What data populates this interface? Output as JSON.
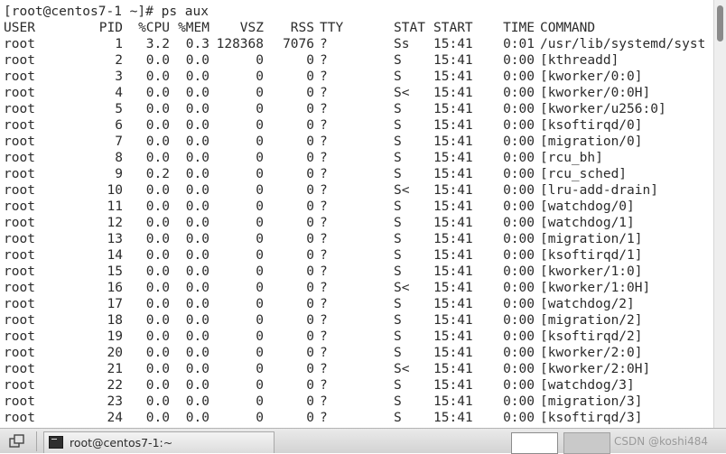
{
  "terminal": {
    "prompt": "[root@centos7-1 ~]# ps aux",
    "headers": [
      "USER",
      "PID",
      "%CPU",
      "%MEM",
      "VSZ",
      "RSS",
      "TTY",
      "STAT",
      "START",
      "TIME",
      "COMMAND"
    ],
    "rows": [
      [
        "root",
        "1",
        "3.2",
        "0.3",
        "128368",
        "7076",
        "?",
        "Ss",
        "15:41",
        "0:01",
        "/usr/lib/systemd/syst"
      ],
      [
        "root",
        "2",
        "0.0",
        "0.0",
        "0",
        "0",
        "?",
        "S",
        "15:41",
        "0:00",
        "[kthreadd]"
      ],
      [
        "root",
        "3",
        "0.0",
        "0.0",
        "0",
        "0",
        "?",
        "S",
        "15:41",
        "0:00",
        "[kworker/0:0]"
      ],
      [
        "root",
        "4",
        "0.0",
        "0.0",
        "0",
        "0",
        "?",
        "S<",
        "15:41",
        "0:00",
        "[kworker/0:0H]"
      ],
      [
        "root",
        "5",
        "0.0",
        "0.0",
        "0",
        "0",
        "?",
        "S",
        "15:41",
        "0:00",
        "[kworker/u256:0]"
      ],
      [
        "root",
        "6",
        "0.0",
        "0.0",
        "0",
        "0",
        "?",
        "S",
        "15:41",
        "0:00",
        "[ksoftirqd/0]"
      ],
      [
        "root",
        "7",
        "0.0",
        "0.0",
        "0",
        "0",
        "?",
        "S",
        "15:41",
        "0:00",
        "[migration/0]"
      ],
      [
        "root",
        "8",
        "0.0",
        "0.0",
        "0",
        "0",
        "?",
        "S",
        "15:41",
        "0:00",
        "[rcu_bh]"
      ],
      [
        "root",
        "9",
        "0.2",
        "0.0",
        "0",
        "0",
        "?",
        "S",
        "15:41",
        "0:00",
        "[rcu_sched]"
      ],
      [
        "root",
        "10",
        "0.0",
        "0.0",
        "0",
        "0",
        "?",
        "S<",
        "15:41",
        "0:00",
        "[lru-add-drain]"
      ],
      [
        "root",
        "11",
        "0.0",
        "0.0",
        "0",
        "0",
        "?",
        "S",
        "15:41",
        "0:00",
        "[watchdog/0]"
      ],
      [
        "root",
        "12",
        "0.0",
        "0.0",
        "0",
        "0",
        "?",
        "S",
        "15:41",
        "0:00",
        "[watchdog/1]"
      ],
      [
        "root",
        "13",
        "0.0",
        "0.0",
        "0",
        "0",
        "?",
        "S",
        "15:41",
        "0:00",
        "[migration/1]"
      ],
      [
        "root",
        "14",
        "0.0",
        "0.0",
        "0",
        "0",
        "?",
        "S",
        "15:41",
        "0:00",
        "[ksoftirqd/1]"
      ],
      [
        "root",
        "15",
        "0.0",
        "0.0",
        "0",
        "0",
        "?",
        "S",
        "15:41",
        "0:00",
        "[kworker/1:0]"
      ],
      [
        "root",
        "16",
        "0.0",
        "0.0",
        "0",
        "0",
        "?",
        "S<",
        "15:41",
        "0:00",
        "[kworker/1:0H]"
      ],
      [
        "root",
        "17",
        "0.0",
        "0.0",
        "0",
        "0",
        "?",
        "S",
        "15:41",
        "0:00",
        "[watchdog/2]"
      ],
      [
        "root",
        "18",
        "0.0",
        "0.0",
        "0",
        "0",
        "?",
        "S",
        "15:41",
        "0:00",
        "[migration/2]"
      ],
      [
        "root",
        "19",
        "0.0",
        "0.0",
        "0",
        "0",
        "?",
        "S",
        "15:41",
        "0:00",
        "[ksoftirqd/2]"
      ],
      [
        "root",
        "20",
        "0.0",
        "0.0",
        "0",
        "0",
        "?",
        "S",
        "15:41",
        "0:00",
        "[kworker/2:0]"
      ],
      [
        "root",
        "21",
        "0.0",
        "0.0",
        "0",
        "0",
        "?",
        "S<",
        "15:41",
        "0:00",
        "[kworker/2:0H]"
      ],
      [
        "root",
        "22",
        "0.0",
        "0.0",
        "0",
        "0",
        "?",
        "S",
        "15:41",
        "0:00",
        "[watchdog/3]"
      ],
      [
        "root",
        "23",
        "0.0",
        "0.0",
        "0",
        "0",
        "?",
        "S",
        "15:41",
        "0:00",
        "[migration/3]"
      ],
      [
        "root",
        "24",
        "0.0",
        "0.0",
        "0",
        "0",
        "?",
        "S",
        "15:41",
        "0:00",
        "[ksoftirqd/3]"
      ]
    ]
  },
  "taskbar": {
    "show_desktop_icon": "show-desktop-icon",
    "task_icon": "terminal-icon",
    "task_label": "root@centos7-1:~",
    "watermark": "CSDN @koshi484"
  }
}
